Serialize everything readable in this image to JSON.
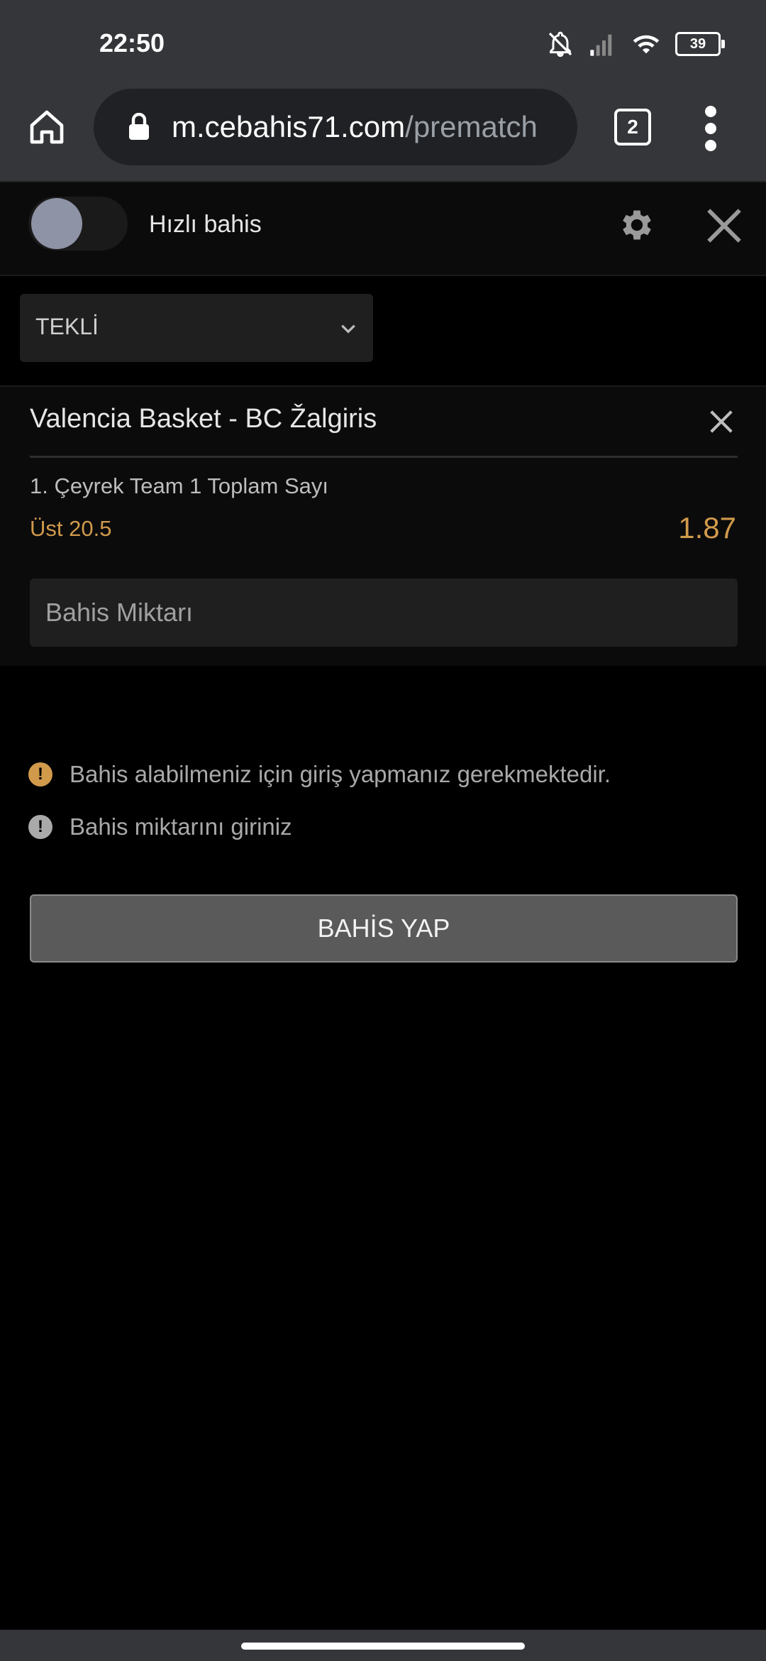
{
  "status_bar": {
    "time": "22:50",
    "battery": "39",
    "icons": [
      "bell-off-icon",
      "signal-icon",
      "wifi-icon",
      "battery-icon"
    ]
  },
  "browser": {
    "url_host": "m.cebahis71.com",
    "url_path": "/prematch",
    "tab_count": "2"
  },
  "header": {
    "quick_bet_label": "Hızlı bahis"
  },
  "bet_type": {
    "selected": "TEKLİ"
  },
  "bet": {
    "match": "Valencia Basket - BC Žalgiris",
    "market": "1. Çeyrek Team 1 Toplam Sayı",
    "selection": "Üst 20.5",
    "odds": "1.87",
    "stake_placeholder": "Bahis Miktarı"
  },
  "messages": [
    {
      "text": "Bahis alabilmeniz için giriş yapmanız gerekmektedir.",
      "color": "#d19a4b"
    },
    {
      "text": "Bahis miktarını giriniz",
      "color": "#a9a9a9"
    }
  ],
  "submit_label": "BAHİS YAP",
  "colors": {
    "accent": "#d19a4b",
    "background": "#000000",
    "panel": "#0b0b0b",
    "browser_chrome": "#35363a"
  }
}
